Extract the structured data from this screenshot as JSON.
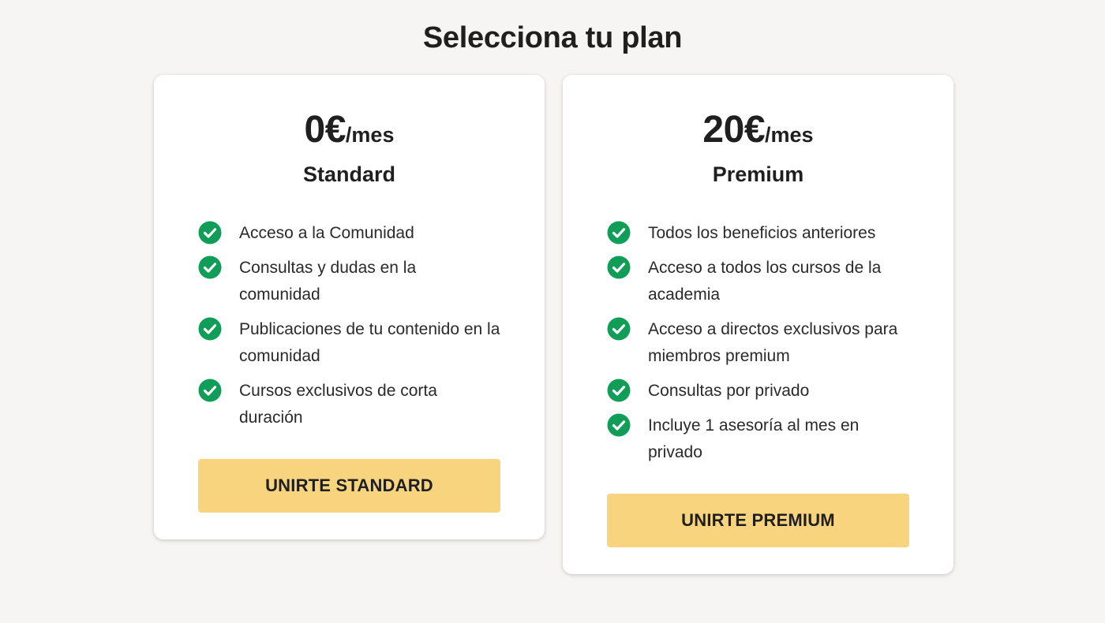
{
  "page": {
    "title": "Selecciona tu plan"
  },
  "colors": {
    "background": "#f6f5f3",
    "card": "#ffffff",
    "check": "#0f9d58",
    "button": "#f8d47f",
    "text": "#1f1f1f"
  },
  "plans": [
    {
      "price": "0€",
      "period": "/mes",
      "name": "Standard",
      "features": [
        "Acceso a la Comunidad",
        "Consultas y dudas en la comunidad",
        "Publicaciones de tu contenido en la comunidad",
        "Cursos exclusivos de corta duración"
      ],
      "button_label": "UNIRTE STANDARD",
      "feature_icon": "check-circle-icon"
    },
    {
      "price": "20€",
      "period": "/mes",
      "name": "Premium",
      "features": [
        "Todos los beneficios anteriores",
        "Acceso a todos los cursos de la academia",
        "Acceso a directos exclusivos para miembros premium",
        "Consultas por privado",
        "Incluye 1 asesoría al mes en privado"
      ],
      "button_label": "UNIRTE PREMIUM",
      "feature_icon": "check-circle-icon"
    }
  ]
}
